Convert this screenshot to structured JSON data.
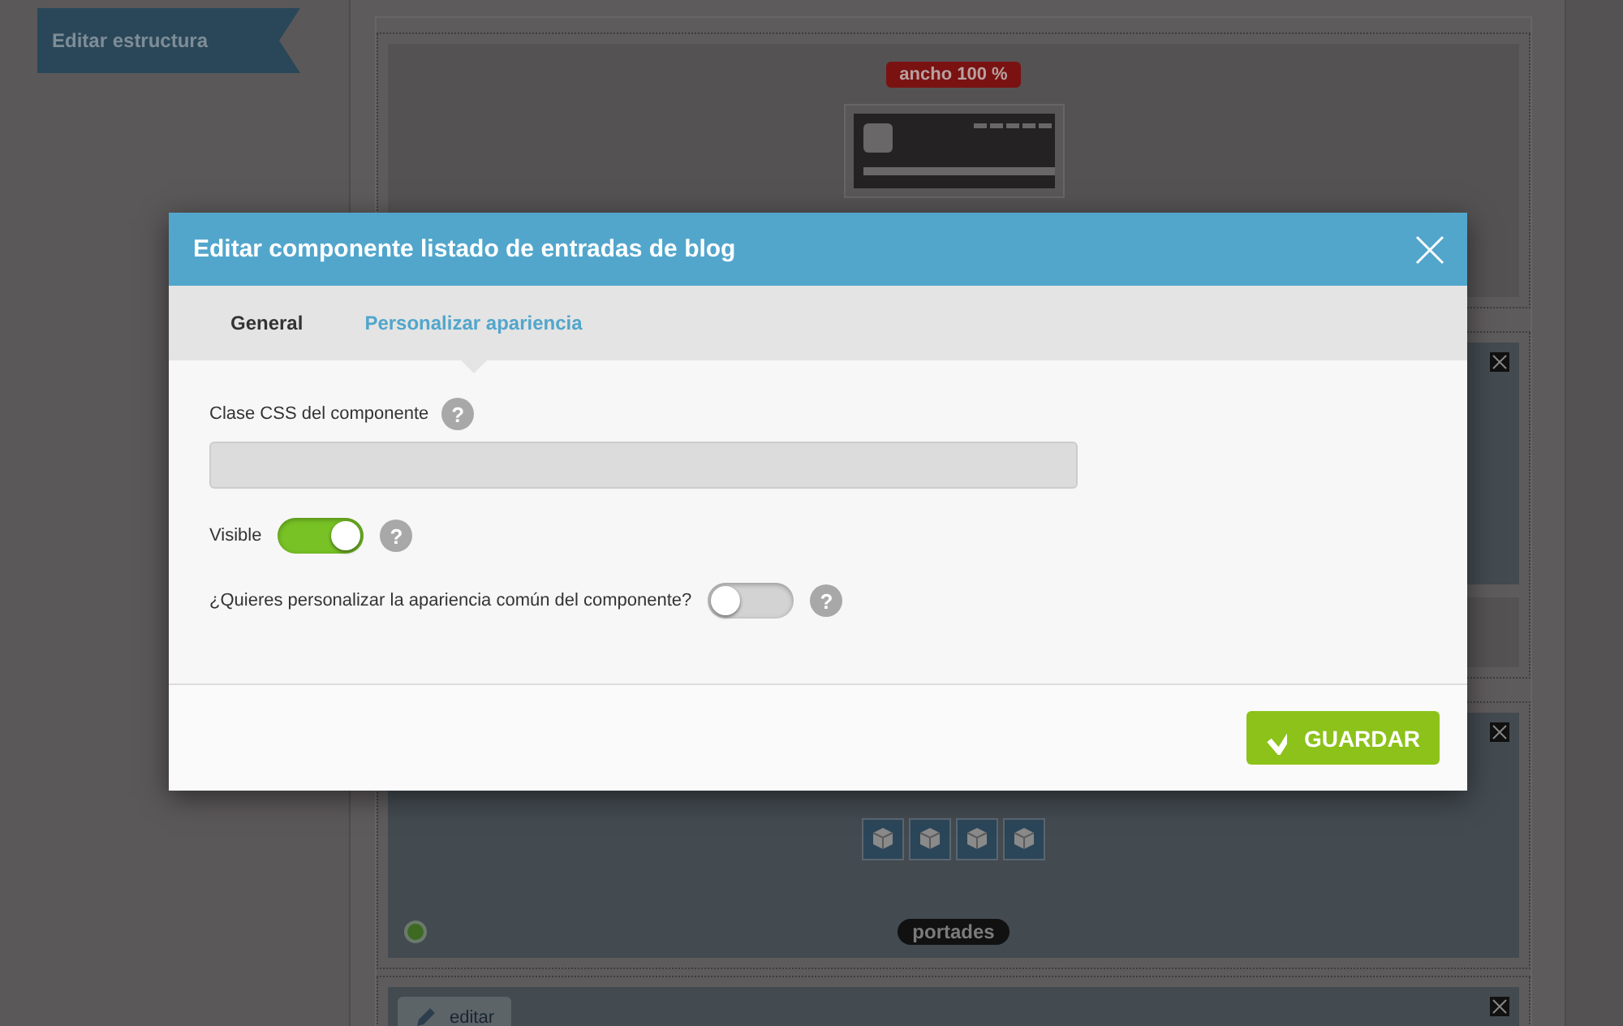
{
  "sidebar": {
    "ribbon": "Editar estructura"
  },
  "structure": {
    "width_badge": "ancho 100 %",
    "section_label": "portades",
    "edit_button": "editar"
  },
  "dialog": {
    "title": "Editar componente listado de entradas de blog",
    "tabs": [
      {
        "label": "General",
        "selected": false
      },
      {
        "label": "Personalizar apariencia",
        "selected": true
      }
    ],
    "fields": [
      {
        "kind": "text",
        "label": "Clase CSS del componente",
        "help": "?"
      },
      {
        "kind": "toggle",
        "label": "Visible",
        "on": true,
        "help": "?"
      },
      {
        "kind": "toggle",
        "label": "¿Quieres personalizar la apariencia común del componente?",
        "on": false,
        "help": "?"
      }
    ],
    "save_button": "GUARDAR"
  }
}
